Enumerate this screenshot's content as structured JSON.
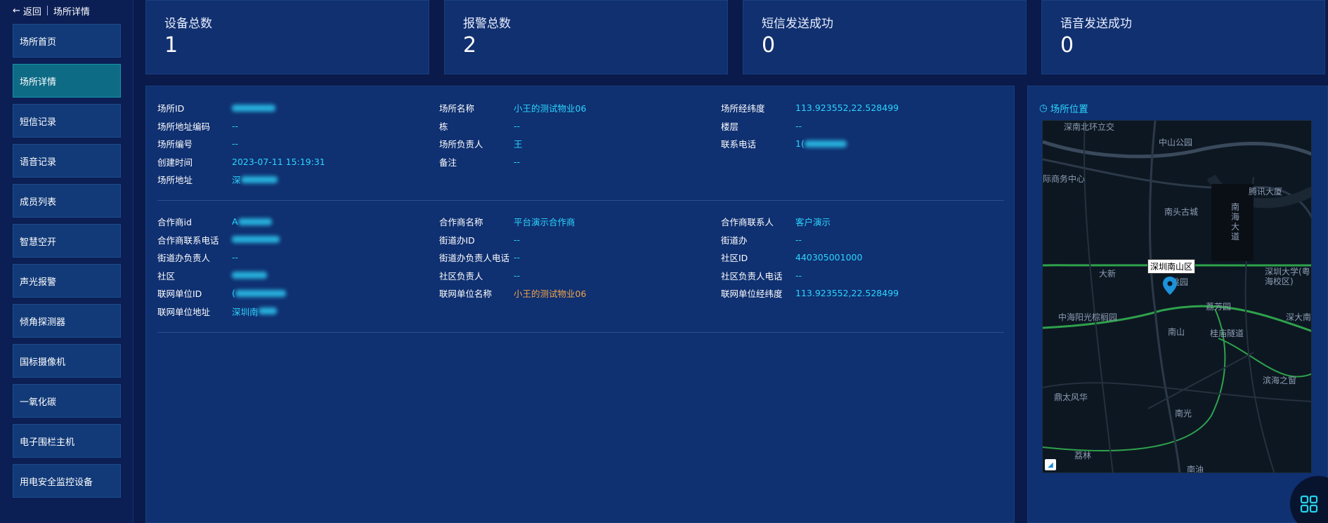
{
  "sidebar": {
    "back_label": "返回",
    "page_title": "场所详情",
    "items": [
      {
        "label": "场所首页"
      },
      {
        "label": "场所详情"
      },
      {
        "label": "短信记录"
      },
      {
        "label": "语音记录"
      },
      {
        "label": "成员列表"
      },
      {
        "label": "智慧空开"
      },
      {
        "label": "声光报警"
      },
      {
        "label": "倾角探测器"
      },
      {
        "label": "国标摄像机"
      },
      {
        "label": "一氧化碳"
      },
      {
        "label": "电子围栏主机"
      },
      {
        "label": "用电安全监控设备"
      }
    ],
    "active_index": 1
  },
  "stats": [
    {
      "label": "设备总数",
      "value": "1"
    },
    {
      "label": "报警总数",
      "value": "2"
    },
    {
      "label": "短信发送成功",
      "value": "0"
    },
    {
      "label": "语音发送成功",
      "value": "0"
    }
  ],
  "place": {
    "id_label": "场所ID",
    "id_value": "",
    "name_label": "场所名称",
    "name_value": "小王的测试物业06",
    "lnglat_label": "场所经纬度",
    "lnglat_value": "113.923552,22.528499",
    "addr_code_label": "场所地址编码",
    "addr_code_value": "--",
    "building_label": "栋",
    "building_value": "--",
    "floor_label": "楼层",
    "floor_value": "--",
    "number_label": "场所编号",
    "number_value": "--",
    "manager_label": "场所负责人",
    "manager_value": "王",
    "phone_label": "联系电话",
    "phone_value": "1(",
    "created_label": "创建时间",
    "created_value": "2023-07-11 15:19:31",
    "remark_label": "备注",
    "remark_value": "--",
    "address_label": "场所地址",
    "address_value": "深"
  },
  "partner": {
    "id_label": "合作商id",
    "id_value": "A",
    "name_label": "合作商名称",
    "name_value": "平台演示合作商",
    "contact_label": "合作商联系人",
    "contact_value": "客户演示",
    "phone_label": "合作商联系电话",
    "phone_value": "",
    "street_id_label": "街道办ID",
    "street_id_value": "--",
    "street_label": "街道办",
    "street_value": "--",
    "street_mgr_label": "街道办负责人",
    "street_mgr_value": "--",
    "street_mgr_phone_label": "街道办负责人电话",
    "street_mgr_phone_value": "--",
    "community_id_label": "社区ID",
    "community_id_value": "440305001000",
    "community_label": "社区",
    "community_value": "",
    "community_mgr_label": "社区负责人",
    "community_mgr_value": "--",
    "community_mgr_phone_label": "社区负责人电话",
    "community_mgr_phone_value": "--",
    "net_id_label": "联网单位ID",
    "net_id_value": "(",
    "net_name_label": "联网单位名称",
    "net_name_value": "小王的测试物业06",
    "net_lnglat_label": "联网单位经纬度",
    "net_lnglat_value": "113.923552,22.528499",
    "net_addr_label": "联网单位地址",
    "net_addr_value": "深圳南"
  },
  "location": {
    "title": "场所位置",
    "popup": "深圳南山区",
    "labels": [
      "深南北环立交",
      "中山公园",
      "际商务中心",
      "腾讯大厦",
      "南头古城",
      "南海大道",
      "大新",
      "桃园",
      "深圳大学(粤海校区)",
      "中海阳光棕榈园",
      "荔芳园",
      "深大南",
      "南山",
      "桂庙隧道",
      "滨海之窗",
      "鼎太风华",
      "南光",
      "荔林",
      "南油"
    ]
  },
  "colors": {
    "accent": "#2bd6ff",
    "orange": "#f2a54a",
    "active_menu": "#0e6b86"
  }
}
